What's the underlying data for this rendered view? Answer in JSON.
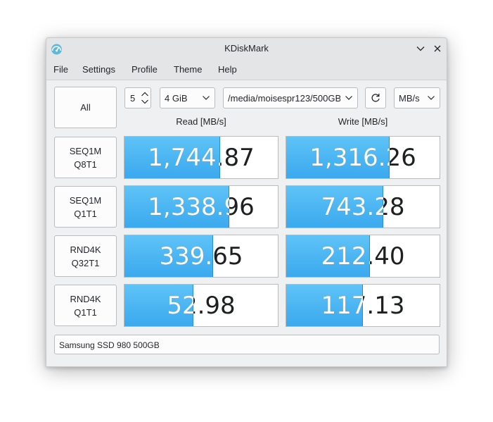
{
  "window": {
    "title": "KDiskMark",
    "icon": "kdiskmark-gauge-icon"
  },
  "menu": [
    "File",
    "Settings",
    "Profile",
    "Theme",
    "Help"
  ],
  "toolbar": {
    "all_label": "All",
    "loops_value": "5",
    "size_value": "4 GiB",
    "path_value": "/media/moisespr123/500GB",
    "unit_value": "MB/s"
  },
  "headers": {
    "read": "Read [MB/s]",
    "write": "Write [MB/s]"
  },
  "tests": [
    {
      "line1": "SEQ1M",
      "line2": "Q8T1",
      "read": "1,744.87",
      "read_pct": 0.623,
      "write": "1,316.26",
      "write_pct": 0.674
    },
    {
      "line1": "SEQ1M",
      "line2": "Q1T1",
      "read": "1,338.96",
      "read_pct": 0.682,
      "write": "743.28",
      "write_pct": 0.632
    },
    {
      "line1": "RND4K",
      "line2": "Q32T1",
      "read": "339.65",
      "read_pct": 0.577,
      "write": "212.40",
      "write_pct": 0.545
    },
    {
      "line1": "RND4K",
      "line2": "Q1T1",
      "read": "52.98",
      "read_pct": 0.451,
      "write": "117.13",
      "write_pct": 0.5
    }
  ],
  "status": "Samsung SSD 980 500GB",
  "colors": {
    "bar_fill": "#3daee9",
    "window_bg": "#eff0f1"
  }
}
